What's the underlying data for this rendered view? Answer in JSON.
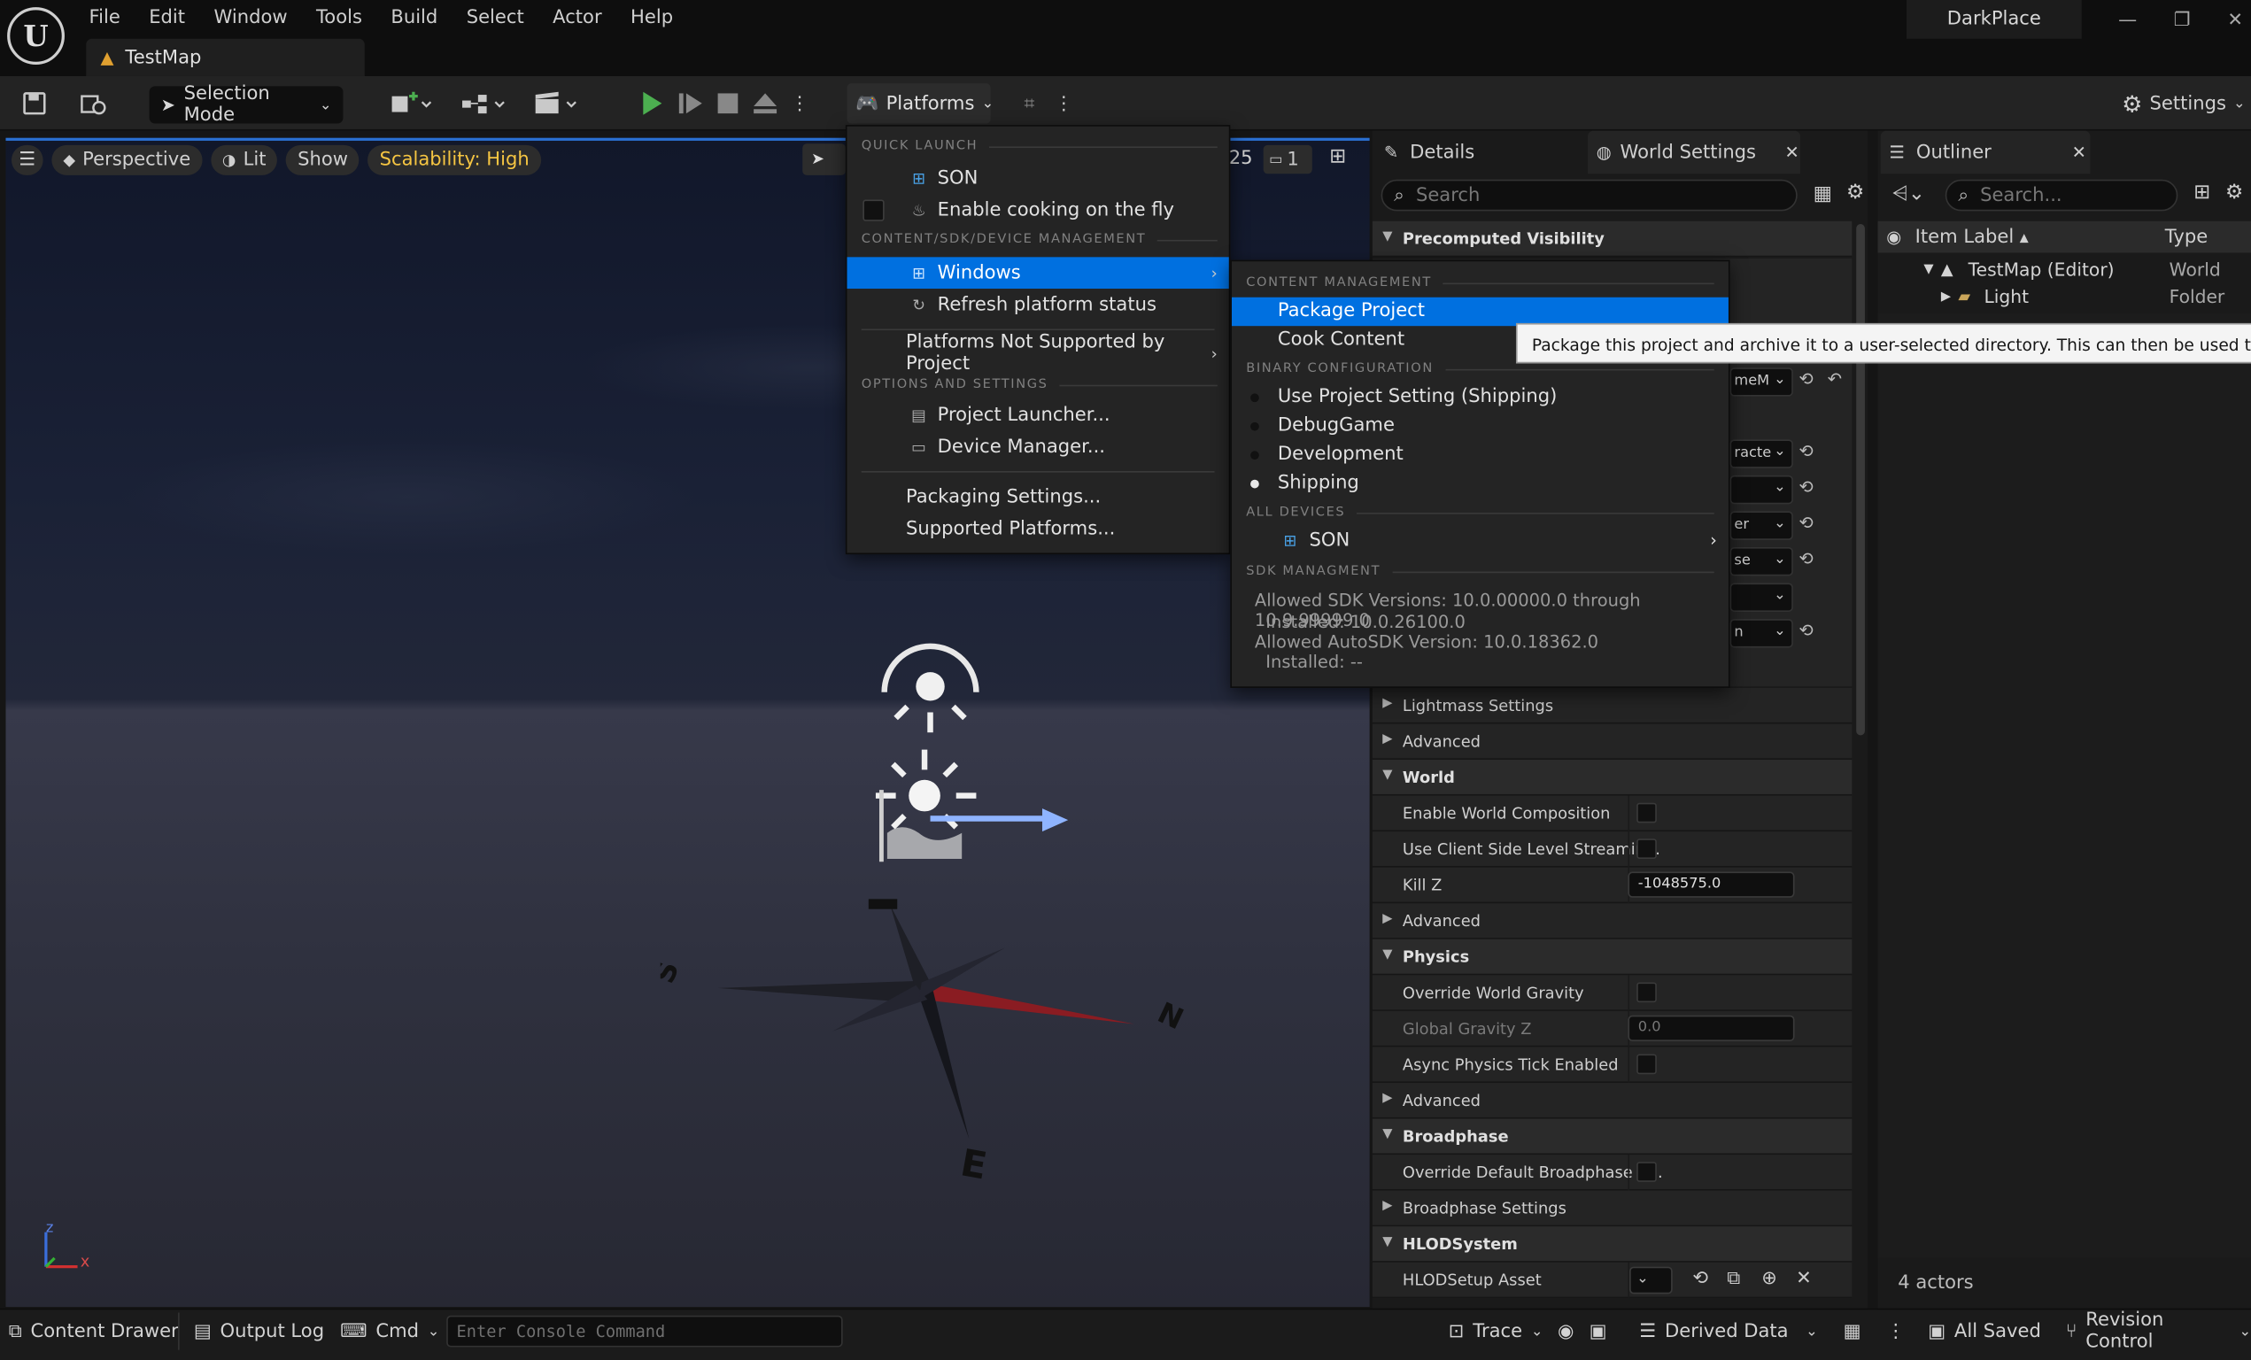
{
  "app": {
    "project": "DarkPlace",
    "tab_title": "TestMap",
    "menu": [
      "File",
      "Edit",
      "Window",
      "Tools",
      "Build",
      "Select",
      "Actor",
      "Help"
    ]
  },
  "toolbar": {
    "selection_mode": "Selection Mode",
    "platforms": "Platforms",
    "settings": "Settings"
  },
  "viewport": {
    "perspective": "Perspective",
    "lit": "Lit",
    "show": "Show",
    "scalability": "Scalability: High",
    "speed": "25",
    "camera_count": "1",
    "compass": {
      "s": "S",
      "n": "N",
      "e": "E"
    },
    "axis": {
      "z": "z",
      "x": "x"
    }
  },
  "platforms_menu": {
    "quick_launch": "QUICK LAUNCH",
    "son": "SON",
    "cook_fly": "Enable cooking on the fly",
    "csd": "CONTENT/SDK/DEVICE MANAGEMENT",
    "windows": "Windows",
    "refresh": "Refresh platform status",
    "not_supported": "Platforms Not Supported by Project",
    "options": "OPTIONS AND SETTINGS",
    "launcher": "Project Launcher...",
    "device_mgr": "Device Manager...",
    "packaging": "Packaging Settings...",
    "supported": "Supported Platforms..."
  },
  "windows_submenu": {
    "content_mgmt": "CONTENT MANAGEMENT",
    "package": "Package Project",
    "cook": "Cook Content",
    "binary": "BINARY CONFIGURATION",
    "configs": [
      "Use Project Setting (Shipping)",
      "DebugGame",
      "Development",
      "Shipping"
    ],
    "all_devices": "ALL DEVICES",
    "son": "SON",
    "sdk_mgmt": "SDK MANAGMENT",
    "sdk_lines": [
      "Allowed SDK Versions: 10.0.00000.0 through 10.9.99999.0",
      "  Installed: 10.0.26100.0",
      "Allowed AutoSDK Version: 10.0.18362.0",
      "  Installed: --"
    ]
  },
  "tooltip": "Package this project and archive it to a user-selected directory. This can then be used to install and run.",
  "details": {
    "tab_details": "Details",
    "tab_world": "World Settings",
    "search_placeholder": "Search",
    "clipped_values": [
      "meM",
      "racte",
      "er",
      "se",
      "n"
    ],
    "rows": [
      {
        "type": "cat",
        "label": "Lightmass Settings",
        "collapsed": true,
        "sub": true
      },
      {
        "type": "cat",
        "label": "Advanced",
        "collapsed": true,
        "sub": true
      },
      {
        "type": "cat",
        "label": "World"
      },
      {
        "label": "Enable World Composition",
        "kind": "check"
      },
      {
        "label": "Use Client Side Level Streamin...",
        "kind": "check"
      },
      {
        "label": "Kill Z",
        "kind": "num",
        "value": "-1048575.0"
      },
      {
        "type": "cat",
        "label": "Advanced",
        "collapsed": true,
        "sub": true
      },
      {
        "type": "cat",
        "label": "Physics"
      },
      {
        "label": "Override World Gravity",
        "kind": "check"
      },
      {
        "label": "Global Gravity Z",
        "kind": "num",
        "value": "0.0",
        "disabled": true
      },
      {
        "label": "Async Physics Tick Enabled",
        "kind": "check"
      },
      {
        "type": "cat",
        "label": "Advanced",
        "collapsed": true,
        "sub": true
      },
      {
        "type": "cat",
        "label": "Broadphase"
      },
      {
        "label": "Override Default Broadphase S...",
        "kind": "check"
      },
      {
        "type": "cat",
        "label": "Broadphase Settings",
        "collapsed": true,
        "sub": true
      },
      {
        "type": "cat",
        "label": "HLODSystem"
      },
      {
        "label": "HLODSetup Asset",
        "kind": "asset"
      }
    ],
    "precomputed": "Precomputed Visibility"
  },
  "outliner": {
    "title": "Outliner",
    "search_placeholder": "Search...",
    "col_label": "Item Label",
    "col_type": "Type",
    "items": [
      {
        "label": "TestMap (Editor)",
        "type": "World"
      },
      {
        "label": "Light",
        "type": "Folder"
      }
    ],
    "count": "4 actors"
  },
  "bottom": {
    "content_drawer": "Content Drawer",
    "output_log": "Output Log",
    "cmd": "Cmd",
    "console_placeholder": "Enter Console Command",
    "trace": "Trace",
    "derived": "Derived Data",
    "saved": "All Saved",
    "revision": "Revision Control"
  }
}
